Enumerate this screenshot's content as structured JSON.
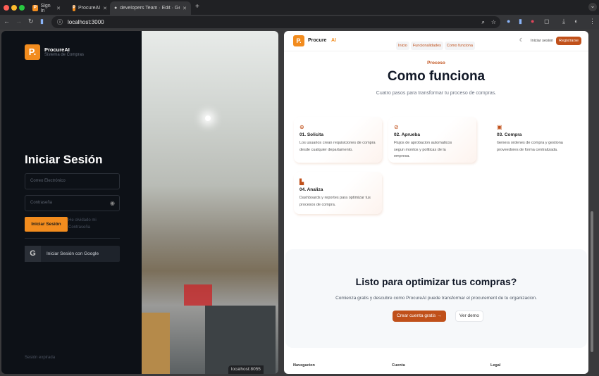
{
  "browser": {
    "tabs": [
      {
        "title": "Sign In"
      },
      {
        "title": "ProcureAI"
      },
      {
        "title": "developers Team · Edit · Gen"
      }
    ],
    "url": "localhost:3000",
    "status_url": "localhost:8055"
  },
  "login": {
    "brand": "ProcureAI",
    "brand_sub": "Sistema de Compras",
    "title": "Iniciar Sesión",
    "email_placeholder": "Correo Electrónico",
    "password_placeholder": "Contraseña",
    "submit": "Iniciar Sesión",
    "forgot": "He olvidado mi Contraseña",
    "google": "Iniciar Sesión con Google",
    "status": "Sesión expirada"
  },
  "site": {
    "brand": "Procure",
    "brand_accent": "AI",
    "nav": [
      "Inicio",
      "Funcionalidades",
      "Como funciona"
    ],
    "login": "Iniciar sesion",
    "register": "Registrarse",
    "eyebrow": "Proceso",
    "title": "Como funciona",
    "subtitle": "Cuatro pasos para transformar tu proceso de compras.",
    "steps": [
      {
        "icon": "plus-circle-icon",
        "title": "01. Solicita",
        "text": "Los usuarios crean requisiciones de compra desde cualquier departamento."
      },
      {
        "icon": "check-circle-icon",
        "title": "02. Aprueba",
        "text": "Flujos de aprobacion automaticos segun montos y politicas de la empresa."
      },
      {
        "icon": "calendar-box-icon",
        "title": "03. Compra",
        "text": "Genera ordenes de compra y gestiona proveedores de forma centralizada."
      },
      {
        "icon": "bar-chart-icon",
        "title": "04. Analiza",
        "text": "Dashboards y reportes para optimizar tus procesos de compra."
      }
    ],
    "cta": {
      "title": "Listo para optimizar tus compras?",
      "text": "Comienza gratis y descubre como ProcureAI puede transformar el procurement de tu organizacion.",
      "primary": "Crear cuenta gratis",
      "secondary": "Ver demo"
    },
    "footer": [
      "Navegacion",
      "Cuenta",
      "Legal"
    ]
  },
  "colors": {
    "accent": "#f28c1e",
    "brand_dark": "#c0501a",
    "dark_bg": "#0d1117"
  }
}
